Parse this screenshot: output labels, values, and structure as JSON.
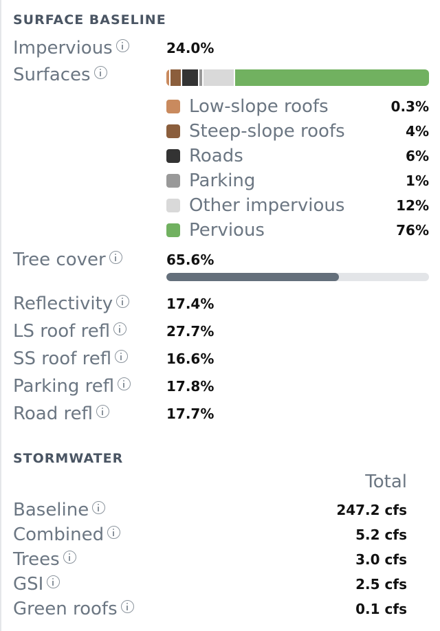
{
  "surface_baseline": {
    "title": "SURFACE BASELINE",
    "impervious": {
      "label": "Impervious",
      "value": "24.0%"
    },
    "surfaces": {
      "label": "Surfaces",
      "segments": [
        {
          "name": "Low-slope roofs",
          "pct_text": "0.3%",
          "share": 0.003,
          "color": "#c98a5e"
        },
        {
          "name": "Steep-slope roofs",
          "pct_text": "4%",
          "share": 0.04,
          "color": "#8b5e3c"
        },
        {
          "name": "Roads",
          "pct_text": "6%",
          "share": 0.06,
          "color": "#333333"
        },
        {
          "name": "Parking",
          "pct_text": "1%",
          "share": 0.01,
          "color": "#999999"
        },
        {
          "name": "Other impervious",
          "pct_text": "12%",
          "share": 0.12,
          "color": "#d9d9d9"
        },
        {
          "name": "Pervious",
          "pct_text": "76%",
          "share": 0.76,
          "color": "#71b160"
        }
      ]
    },
    "tree_cover": {
      "label": "Tree cover",
      "value": "65.6%",
      "fraction": 0.656
    },
    "reflectivity": [
      {
        "label": "Reflectivity",
        "value": "17.4%"
      },
      {
        "label": "LS roof refl",
        "value": "27.7%"
      },
      {
        "label": "SS roof refl",
        "value": "16.6%"
      },
      {
        "label": "Parking refl",
        "value": "17.8%"
      },
      {
        "label": "Road refl",
        "value": "17.7%"
      }
    ]
  },
  "stormwater": {
    "title": "STORMWATER",
    "column_header": "Total",
    "rows": [
      {
        "label": "Baseline",
        "value": "247.2 cfs"
      },
      {
        "label": "Combined",
        "value": "5.2 cfs"
      },
      {
        "label": "Trees",
        "value": "3.0 cfs"
      },
      {
        "label": "GSI",
        "value": "2.5 cfs"
      },
      {
        "label": "Green roofs",
        "value": "0.1 cfs"
      }
    ]
  }
}
